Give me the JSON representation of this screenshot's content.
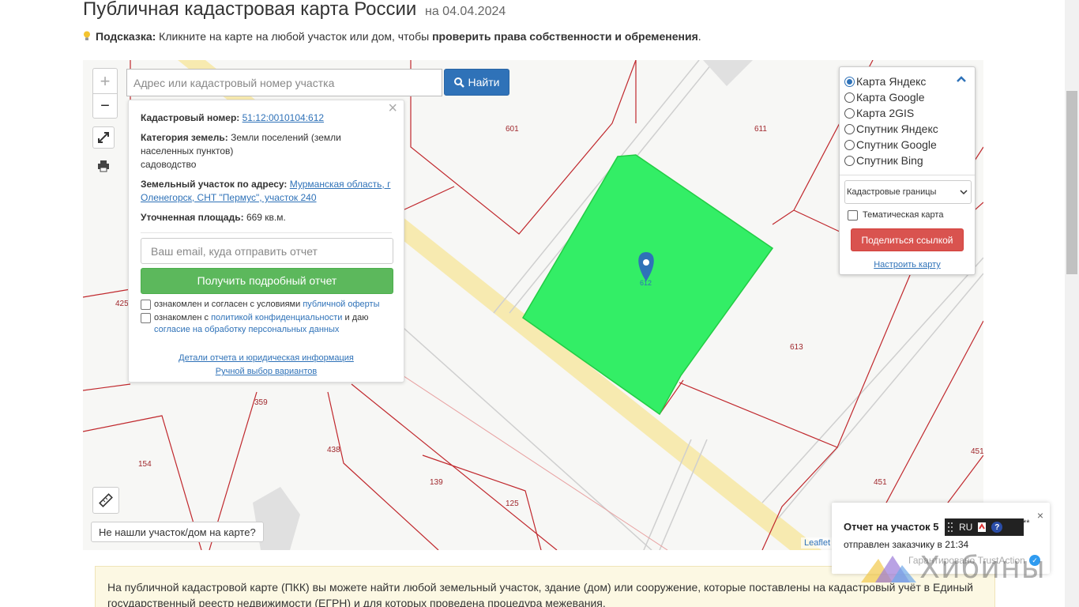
{
  "header": {
    "title": "Публичная кадастровая карта России",
    "date": "на 04.04.2024"
  },
  "hint": {
    "label": "Подсказка:",
    "text": " Кликните на карте на любой участок или дом, чтобы ",
    "emphasis": "проверить права собственности и обременения",
    "tail": "."
  },
  "search": {
    "placeholder": "Адрес или кадастровый номер участка",
    "button": "Найти"
  },
  "zoom": {
    "in": "+",
    "out": "−"
  },
  "popup": {
    "cadastral_label": "Кадастровый номер:",
    "cadastral_value": "51:12:0010104:612",
    "category_label": "Категория земель:",
    "category_value": "Земли поселений (земли населенных пунктов)",
    "category_sub": "садоводство",
    "address_label": "Земельный участок по адресу:",
    "address_value": "Мурманская область, г Оленегорск, СНТ \"Пермус\", участок 240",
    "area_label": "Уточненная площадь:",
    "area_value": "669 кв.м.",
    "email_placeholder": "Ваш email, куда отправить отчет",
    "report_button": "Получить подробный отчет",
    "agree1_text": "ознакомлен и согласен с условиями ",
    "agree1_link": "публичной оферты",
    "agree2_text": "ознакомлен с ",
    "agree2_link": "политикой конфиденциальности",
    "agree2_mid": " и даю",
    "agree2_link2": "согласие на обработку персональных данных",
    "link_details": "Детали отчета и юридическая информация",
    "link_manual": "Ручной выбор вариантов"
  },
  "layers": {
    "options": [
      {
        "label": "Карта Яндекс",
        "selected": true
      },
      {
        "label": "Карта Google",
        "selected": false
      },
      {
        "label": "Карта 2GIS",
        "selected": false
      },
      {
        "label": "Спутник Яндекс",
        "selected": false
      },
      {
        "label": "Спутник Google",
        "selected": false
      },
      {
        "label": "Спутник Bing",
        "selected": false
      }
    ],
    "select_value": "Кадастровые границы",
    "thematic": "Тематическая карта",
    "share": "Поделиться ссылкой",
    "setup": "Настроить карту"
  },
  "map_labels": {
    "l601": "601",
    "l611": "611",
    "l612": "612",
    "l613": "613",
    "l425": "425",
    "l359": "359",
    "l438": "438",
    "l154": "154",
    "l139": "139",
    "l125": "125",
    "l451a": "451",
    "l451b": "451"
  },
  "not_found": "Не нашли участок/дом на карте?",
  "leaflet": "Leaflet",
  "info_text": "На публичной кадастровой карте (ПКК) вы можете найти любой земельный участок, здание (дом) или сооружение, которые поставлены на кадастровый учёт в Единый государственный реестр недвижимости (ЕГРН) и для которых проведена процедура межевания.",
  "toast": {
    "title": "Отчет на участок 5",
    "subtitle": "отправлен заказчику в 21:34",
    "guarantee": "Гарантировано TrustAction",
    "close": "×"
  },
  "lang_bar": {
    "lang": "RU",
    "help": "?",
    "suffix": "**"
  },
  "watermark": "Хибины",
  "colors": {
    "accent": "#2f72b8",
    "parcel": "#33ee66",
    "road": "#f7eab0",
    "boundary": "#c0282d",
    "share": "#d9534f",
    "report": "#5cb85c"
  }
}
